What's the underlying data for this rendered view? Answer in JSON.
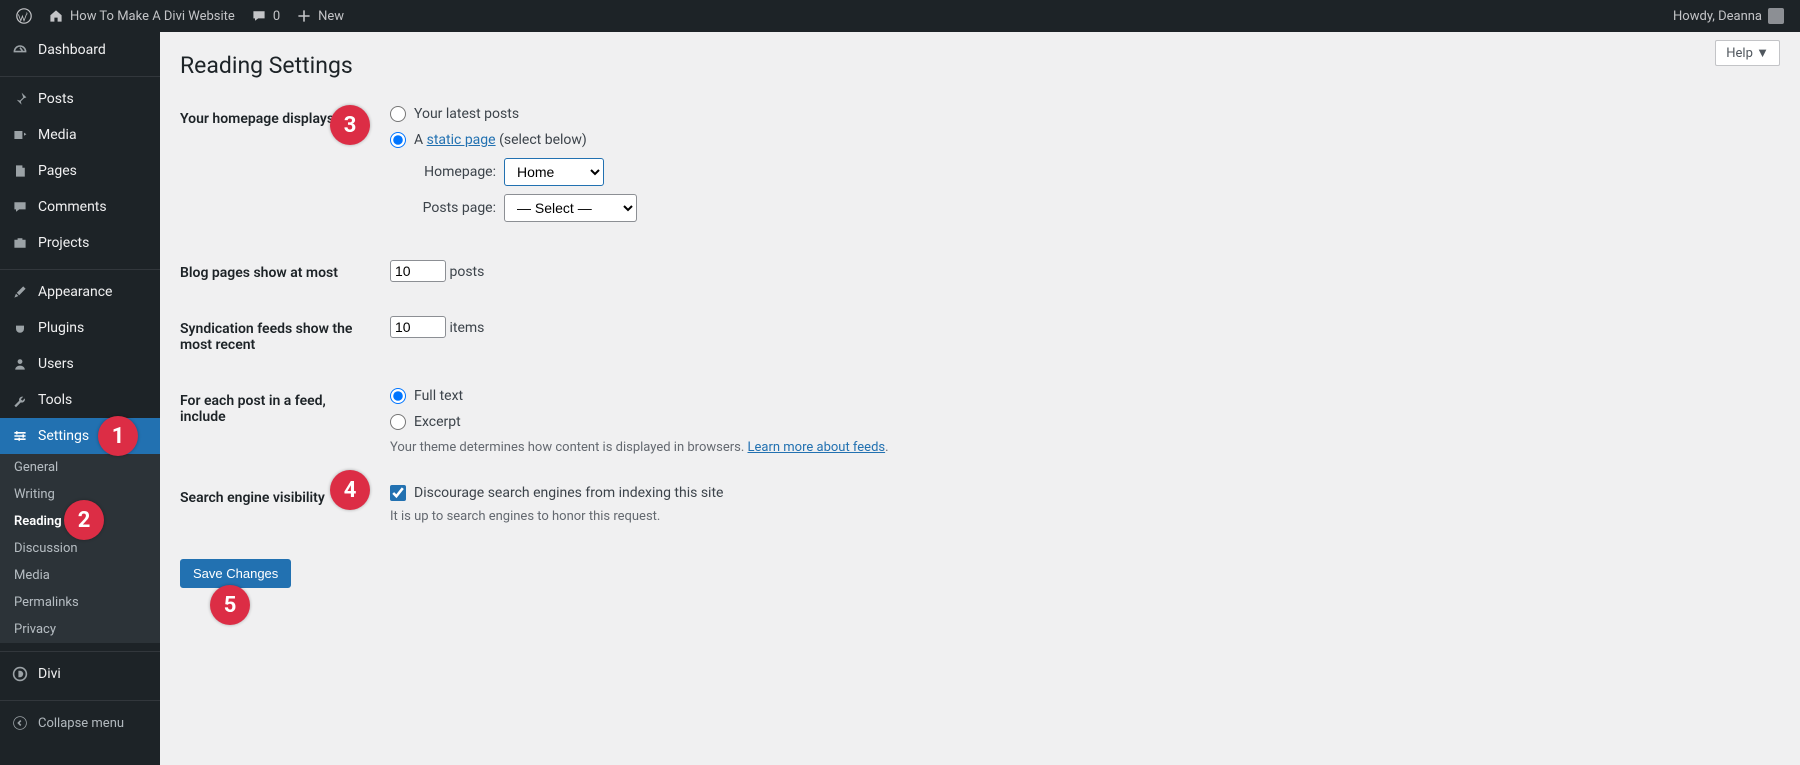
{
  "adminbar": {
    "site_title": "How To Make A Divi Website",
    "comments_count": "0",
    "new_label": "New",
    "howdy": "Howdy, Deanna"
  },
  "sidebar": {
    "main": [
      {
        "icon": "dashboard",
        "label": "Dashboard"
      },
      {
        "icon": "pin",
        "label": "Posts"
      },
      {
        "icon": "media",
        "label": "Media"
      },
      {
        "icon": "page",
        "label": "Pages"
      },
      {
        "icon": "comment",
        "label": "Comments"
      },
      {
        "icon": "portfolio",
        "label": "Projects"
      },
      {
        "icon": "brush",
        "label": "Appearance"
      },
      {
        "icon": "plug",
        "label": "Plugins"
      },
      {
        "icon": "user",
        "label": "Users"
      },
      {
        "icon": "wrench",
        "label": "Tools"
      },
      {
        "icon": "sliders",
        "label": "Settings"
      }
    ],
    "settings_sub": [
      "General",
      "Writing",
      "Reading",
      "Discussion",
      "Media",
      "Permalinks",
      "Privacy"
    ],
    "divi_label": "Divi",
    "collapse_label": "Collapse menu"
  },
  "content": {
    "help_label": "Help",
    "page_title": "Reading Settings",
    "rows": {
      "homepage_displays_label": "Your homepage displays",
      "latest_posts_label": "Your latest posts",
      "static_page_prefix": "A ",
      "static_page_link": "static page",
      "static_page_suffix": "(select below)",
      "homepage_label": "Homepage:",
      "homepage_value": "Home",
      "posts_page_label": "Posts page:",
      "posts_page_value": "— Select —",
      "blog_pages_label": "Blog pages show at most",
      "blog_pages_value": "10",
      "blog_pages_unit": "posts",
      "syndication_label": "Syndication feeds show the most recent",
      "syndication_value": "10",
      "syndication_unit": "items",
      "feed_include_label": "For each post in a feed, include",
      "full_text_label": "Full text",
      "excerpt_label": "Excerpt",
      "feed_desc_prefix": "Your theme determines how content is displayed in browsers. ",
      "feed_desc_link": "Learn more about feeds",
      "feed_desc_suffix": ".",
      "search_visibility_label": "Search engine visibility",
      "discourage_label": "Discourage search engines from indexing this site",
      "discourage_note": "It is up to search engines to honor this request."
    },
    "save_label": "Save Changes"
  },
  "callouts": {
    "c1": "1",
    "c2": "2",
    "c3": "3",
    "c4": "4",
    "c5": "5"
  },
  "colors": {
    "accent": "#2271b1",
    "callout": "#dc2d45"
  }
}
